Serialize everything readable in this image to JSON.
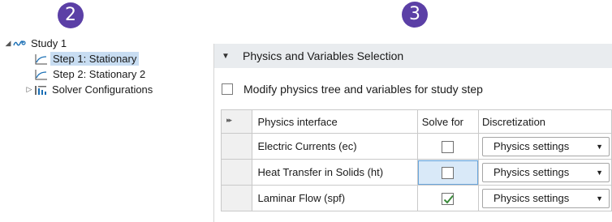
{
  "callouts": {
    "left": "2",
    "right": "3"
  },
  "tree": {
    "study_label": "Study 1",
    "step1_label": "Step 1: Stationary",
    "step2_label": "Step 2: Stationary 2",
    "solver_label": "Solver Configurations",
    "selected_item": "Step 1: Stationary"
  },
  "panel": {
    "section_title": "Physics and Variables Selection",
    "modify_checkbox_label": "Modify physics tree and variables for study step",
    "modify_checked": false,
    "table": {
      "headers": {
        "physics": "Physics interface",
        "solve": "Solve for",
        "discretization": "Discretization"
      },
      "rows": [
        {
          "physics": "Electric Currents (ec)",
          "solve_for": false,
          "discretization": "Physics settings"
        },
        {
          "physics": "Heat Transfer in Solids (ht)",
          "solve_for": false,
          "discretization": "Physics settings"
        },
        {
          "physics": "Laminar Flow (spf)",
          "solve_for": true,
          "discretization": "Physics settings"
        }
      ]
    }
  },
  "colors": {
    "callout": "#5b3fa6",
    "selection": "#c8ddf2",
    "header_bg": "#e9ecef",
    "check": "#3a8a3a"
  }
}
